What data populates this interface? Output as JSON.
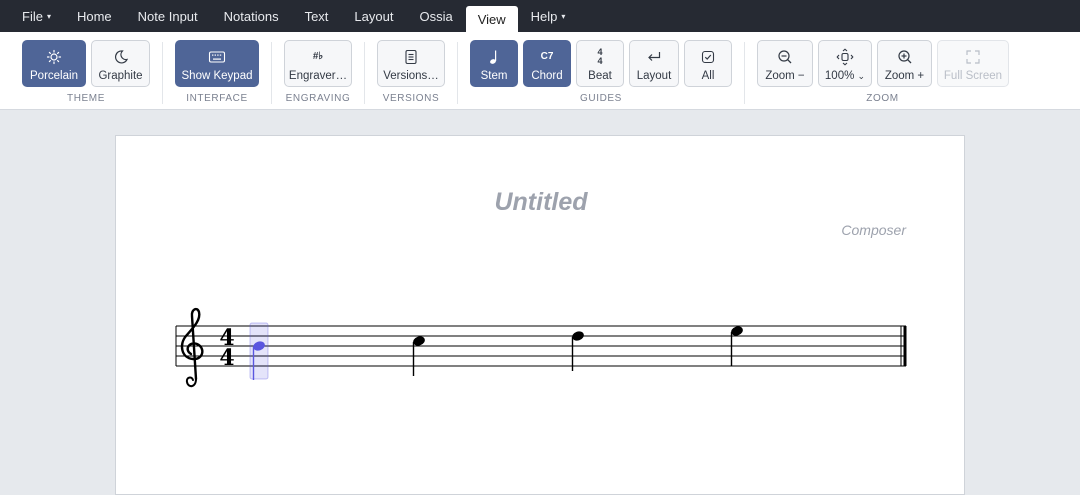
{
  "menubar": {
    "items": [
      {
        "label": "File",
        "caret": "▾"
      },
      {
        "label": "Home"
      },
      {
        "label": "Note Input"
      },
      {
        "label": "Notations"
      },
      {
        "label": "Text"
      },
      {
        "label": "Layout"
      },
      {
        "label": "Ossia"
      },
      {
        "label": "View",
        "active": true
      },
      {
        "label": "Help",
        "caret": "▾"
      }
    ]
  },
  "ribbon": {
    "theme": {
      "label": "THEME",
      "porcelain": "Porcelain",
      "graphite": "Graphite"
    },
    "interface": {
      "label": "INTERFACE",
      "show_keypad": "Show Keypad"
    },
    "engraving": {
      "label": "ENGRAVING",
      "engraver": "Engraver…",
      "icon_text": "#♭"
    },
    "versions": {
      "label": "VERSIONS",
      "versions": "Versions…"
    },
    "guides": {
      "label": "GUIDES",
      "stem": "Stem",
      "chord": "Chord",
      "chord_icon": "C7",
      "beat": "Beat",
      "beat_top": "4",
      "beat_bottom": "4",
      "layout": "Layout",
      "all": "All"
    },
    "zoom": {
      "label": "ZOOM",
      "zoom_out": "Zoom −",
      "zoom_level": "100%",
      "zoom_level_caret": "⌄",
      "zoom_in": "Zoom +",
      "full_screen": "Full Screen"
    }
  },
  "score": {
    "title": "Untitled",
    "composer": "Composer",
    "time_signature": {
      "top": "4",
      "bottom": "4"
    },
    "selection_color": "#5a56e0"
  },
  "colors": {
    "menubar": "#262a33",
    "accent": "#4f6597",
    "canvas": "#e6e9ed"
  }
}
